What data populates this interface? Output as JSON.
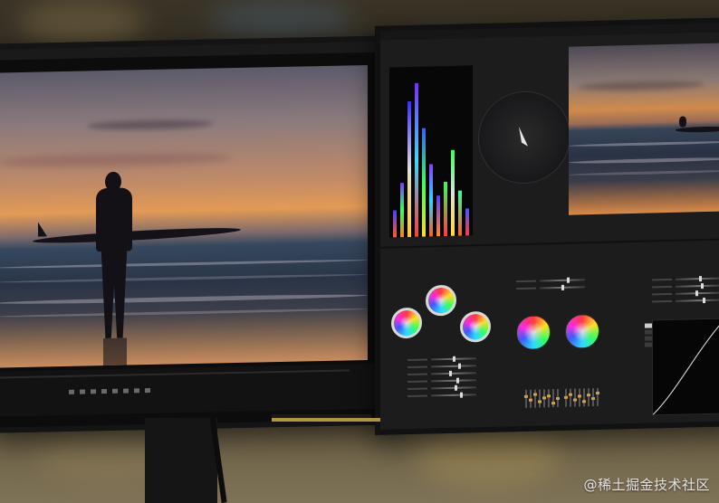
{
  "scene": {
    "description_colors": {
      "sunset_orange": "#e39a55",
      "ui_accent_blue": "#4a8cff",
      "panel_dark": "#1c1c1d"
    }
  },
  "left_monitor": {
    "menu_items": [
      "",
      "",
      "",
      "",
      "",
      "",
      "",
      "",
      ""
    ]
  },
  "right_monitor": {
    "workspace_tabs": [
      "",
      "",
      "",
      "",
      "",
      "",
      "",
      "",
      ""
    ],
    "scope_tabs": [
      "",
      "",
      "",
      "",
      ""
    ],
    "lumetri_tabs": [
      "",
      "",
      "",
      "",
      "",
      "",
      ""
    ],
    "section_titles": [
      "",
      "",
      ""
    ],
    "timecode": ""
  },
  "watermark": {
    "text": "@稀土掘金技术社区"
  }
}
